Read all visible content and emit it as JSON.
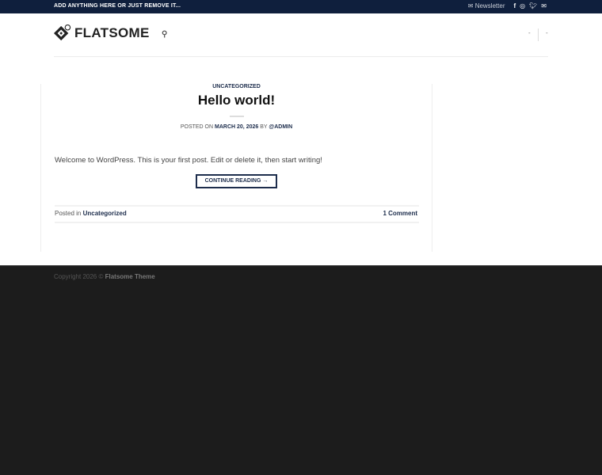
{
  "topbar": {
    "message": "ADD ANYTHING HERE OR JUST REMOVE IT...",
    "newsletter": "Newsletter",
    "icons": [
      "envelope-icon",
      "facebook-icon",
      "instagram-icon",
      "twitter-icon",
      "email-icon"
    ]
  },
  "header": {
    "logo": "FLATSOME",
    "nav_left": "-",
    "nav_right": "-"
  },
  "post": {
    "category": "UNCATEGORIZED",
    "title": "Hello world!",
    "posted_on": "POSTED ON",
    "date": "MARCH 20, 2026",
    "by": "BY",
    "author": "@ADMIN",
    "excerpt": "Welcome to WordPress. This is your first post. Edit or delete it, then start writing!",
    "continue": "CONTINUE READING →",
    "posted_in": "Posted in",
    "posted_in_cat": "Uncategorized",
    "comments": "1 Comment"
  },
  "footer": {
    "copyright": "Copyright 2026 ©",
    "theme": "Flatsome Theme"
  }
}
